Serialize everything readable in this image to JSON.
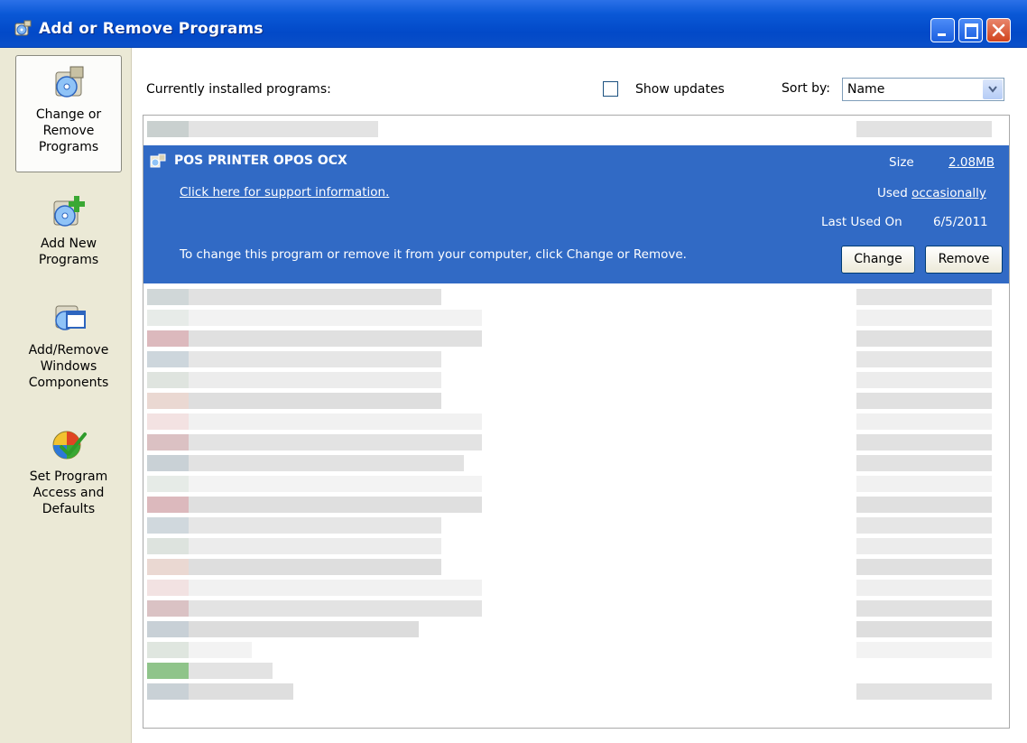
{
  "window": {
    "title": "Add or Remove Programs"
  },
  "sidebar": {
    "items": [
      {
        "label_lines": [
          "Change or",
          "Remove",
          "Programs"
        ],
        "active": true
      },
      {
        "label_lines": [
          "Add New",
          "Programs"
        ]
      },
      {
        "label_lines": [
          "Add/Remove",
          "Windows",
          "Components"
        ]
      },
      {
        "label_lines": [
          "Set Program",
          "Access and",
          "Defaults"
        ]
      }
    ]
  },
  "main": {
    "header": "Currently installed programs:",
    "show_updates": {
      "label": "Show updates",
      "checked": false
    },
    "sort": {
      "label": "Sort by:",
      "value": "Name"
    },
    "selected_program": {
      "name": "POS PRINTER OPOS OCX",
      "support_link": "Click here for support information.",
      "size_label": "Size",
      "size_value": "2.08MB",
      "used_label": "Used",
      "used_value": "occasionally",
      "last_used_label": "Last Used On",
      "last_used_value": "6/5/2011",
      "hint": "To change this program or remove it from your computer, click Change or Remove.",
      "change_label": "Change",
      "remove_label": "Remove"
    }
  },
  "colors": {
    "title_bar": "#0a58d6",
    "selection": "#316ac5",
    "sidebar_bg": "#ebe9d6",
    "window_bg": "#ece9d8"
  }
}
